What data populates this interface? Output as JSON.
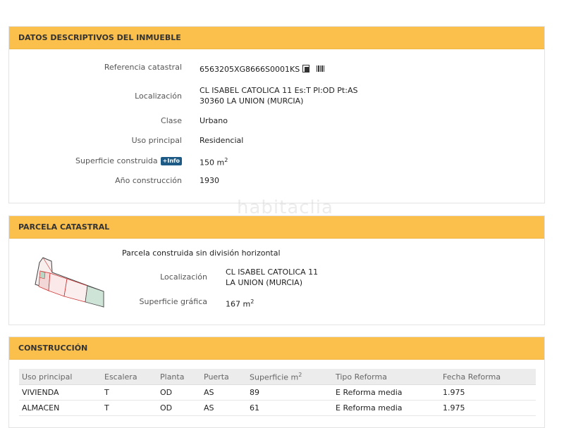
{
  "descriptivos": {
    "title": "DATOS DESCRIPTIVOS DEL INMUEBLE",
    "rows": {
      "ref_label": "Referencia catastral",
      "ref_value": "6563205XG8666S0001KS",
      "loc_label": "Localización",
      "loc_line1": "CL ISABEL CATOLICA 11 Es:T Pl:OD Pt:AS",
      "loc_line2": "30360 LA UNION (MURCIA)",
      "clase_label": "Clase",
      "clase_value": "Urbano",
      "uso_label": "Uso principal",
      "uso_value": "Residencial",
      "sup_label": "Superficie construida",
      "sup_info": "+Info",
      "sup_value": "150 m",
      "sup_unit_sup": "2",
      "anio_label": "Año construcción",
      "anio_value": "1930"
    }
  },
  "watermark": "habitaclia",
  "parcela": {
    "title": "PARCELA CATASTRAL",
    "subtitle": "Parcela construida sin división horizontal",
    "loc_label": "Localización",
    "loc_line1": "CL ISABEL CATOLICA 11",
    "loc_line2": "LA UNION (MURCIA)",
    "sup_label": "Superficie gráfica",
    "sup_value": "167 m",
    "sup_unit_sup": "2"
  },
  "construccion": {
    "title": "CONSTRUCCIÓN",
    "headers": [
      "Uso principal",
      "Escalera",
      "Planta",
      "Puerta",
      "Superficie m",
      "Tipo Reforma",
      "Fecha Reforma"
    ],
    "sup_header_sup": "2",
    "rows": [
      [
        "VIVIENDA",
        "T",
        "OD",
        "AS",
        "89",
        "E Reforma media",
        "1.975"
      ],
      [
        "ALMACEN",
        "T",
        "OD",
        "AS",
        "61",
        "E Reforma media",
        "1.975"
      ]
    ]
  },
  "colors": {
    "header_bg": "#fbc04c",
    "info_badge": "#1d5b86"
  }
}
